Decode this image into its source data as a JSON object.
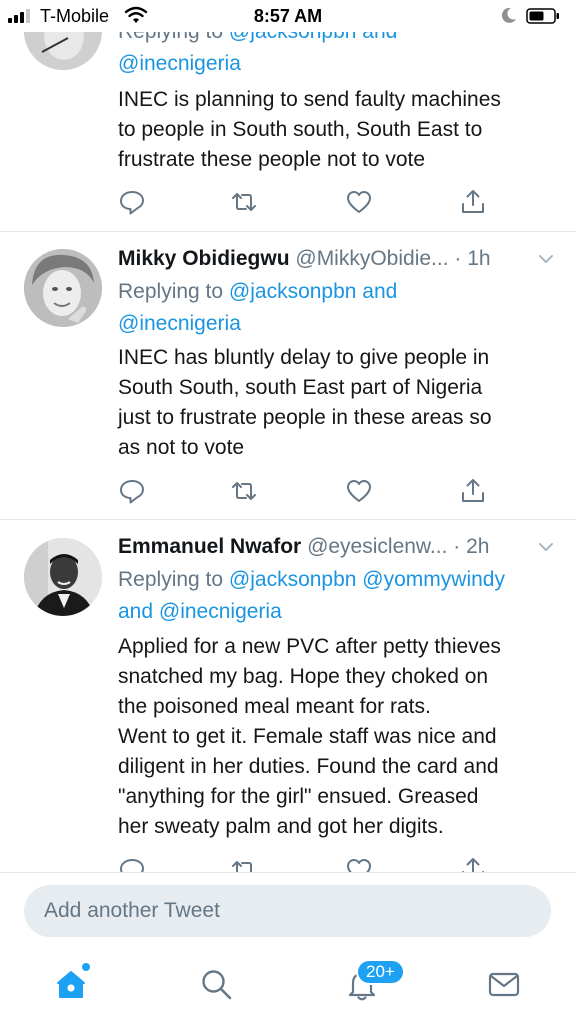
{
  "status_bar": {
    "carrier": "T-Mobile",
    "time": "8:57 AM"
  },
  "tweets": [
    {
      "reply_prefix": "Replying to",
      "reply_line1_mentions": "@jacksonpbn and",
      "reply_line2": "@inecnigeria",
      "text": "INEC is planning to send faulty machines\nto people in South south, South East to\nfrustrate these people not to vote"
    },
    {
      "name": "Mikky Obidiegwu",
      "handle": "@MikkyObidie...",
      "time": "· 1h",
      "reply_prefix": "Replying to",
      "reply_line1_mentions": "@jacksonpbn and",
      "reply_line2": "@inecnigeria",
      "text": "INEC has bluntly delay to give people in\nSouth South, south East part of Nigeria\njust to frustrate people in these areas so\nas not to vote"
    },
    {
      "name": "Emmanuel Nwafor",
      "handle": "@eyesiclenw...",
      "time": "· 2h",
      "reply_prefix": "Replying to",
      "reply_line1_mentions": "@jacksonpbn @yommywindy",
      "reply_line2_and": "and",
      "reply_line2_mention": "@inecnigeria",
      "text": "Applied for a new PVC after petty thieves\nsnatched my bag. Hope they choked on\nthe poisoned meal meant for rats.\nWent to get it. Female staff was nice and\ndiligent in her duties. Found the card and\n\"anything for the girl\" ensued. Greased\nher sweaty palm and got her digits."
    }
  ],
  "compose": {
    "placeholder": "Add another Tweet"
  },
  "tab_bar": {
    "notifications_badge": "20+"
  },
  "icons": {
    "reply": "reply-icon",
    "retweet": "retweet-icon",
    "like": "heart-icon",
    "share": "share-icon",
    "home": "home-icon",
    "search": "search-icon",
    "notifications": "bell-icon",
    "messages": "envelope-icon"
  },
  "colors": {
    "link_blue": "#1b95e0",
    "accent_blue": "#1da1f2",
    "secondary_gray": "#657786",
    "divider": "#e1e8ed"
  }
}
